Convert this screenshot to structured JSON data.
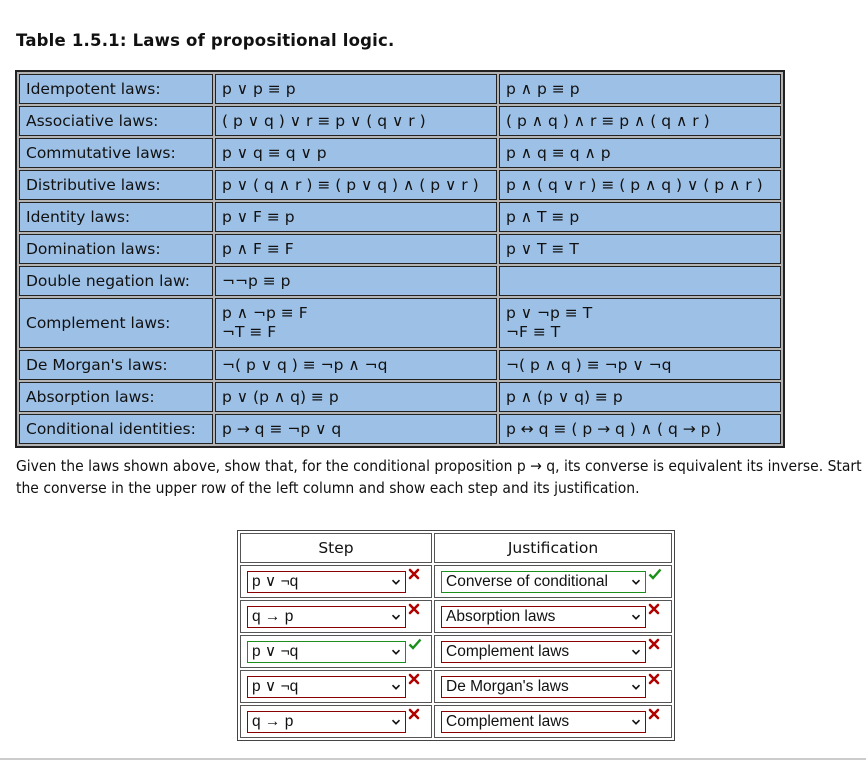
{
  "title": "Table 1.5.1: Laws of propositional logic.",
  "laws": [
    {
      "name": "Idempotent laws:",
      "left": [
        "p ∨ p ≡ p"
      ],
      "right": [
        "p ∧ p ≡ p"
      ]
    },
    {
      "name": "Associative laws:",
      "left": [
        "( p ∨ q ) ∨ r ≡ p ∨ ( q ∨ r )"
      ],
      "right": [
        "( p ∧ q ) ∧ r ≡ p ∧ ( q ∧ r )"
      ]
    },
    {
      "name": "Commutative laws:",
      "left": [
        "p ∨ q ≡ q ∨ p"
      ],
      "right": [
        "p ∧ q ≡ q ∧ p"
      ]
    },
    {
      "name": "Distributive laws:",
      "left": [
        "p ∨ ( q ∧ r ) ≡ ( p ∨ q ) ∧ ( p ∨ r )"
      ],
      "right": [
        "p ∧ ( q ∨ r ) ≡ ( p ∧ q ) ∨ ( p ∧ r )"
      ]
    },
    {
      "name": "Identity laws:",
      "left": [
        "p ∨ F ≡ p"
      ],
      "right": [
        "p ∧ T ≡ p"
      ]
    },
    {
      "name": "Domination laws:",
      "left": [
        "p ∧ F ≡ F"
      ],
      "right": [
        "p ∨ T ≡ T"
      ]
    },
    {
      "name": "Double negation law:",
      "left": [
        "¬¬p ≡ p"
      ],
      "right": []
    },
    {
      "name": "Complement laws:",
      "left": [
        "p ∧ ¬p ≡ F",
        "¬T ≡ F"
      ],
      "right": [
        "p ∨ ¬p ≡ T",
        "¬F ≡ T"
      ]
    },
    {
      "name": "De Morgan's laws:",
      "left": [
        "¬( p ∨ q ) ≡ ¬p ∧ ¬q"
      ],
      "right": [
        "¬( p ∧ q ) ≡ ¬p ∨ ¬q"
      ]
    },
    {
      "name": "Absorption laws:",
      "left": [
        "p ∨ (p ∧ q) ≡ p"
      ],
      "right": [
        "p ∧ (p ∨ q) ≡ p"
      ]
    },
    {
      "name": "Conditional identities:",
      "left": [
        "p → q ≡ ¬p ∨ q"
      ],
      "right": [
        "p ↔ q ≡ ( p → q ) ∧ ( q → p )"
      ]
    }
  ],
  "instructions": "Given the laws shown above, show that, for the conditional proposition p → q, its converse is equivalent its inverse. Start with the converse in the upper row of the left column and show each step and its justification.",
  "proof_table": {
    "headers": {
      "step": "Step",
      "justification": "Justification"
    },
    "rows": [
      {
        "step": "p ∨ ¬q",
        "step_status": "incorrect",
        "justification": "Converse of conditional",
        "justification_status": "correct"
      },
      {
        "step": "q → p",
        "step_status": "incorrect",
        "justification": "Absorption laws",
        "justification_status": "incorrect"
      },
      {
        "step": "p ∨ ¬q",
        "step_status": "correct",
        "justification": "Complement laws",
        "justification_status": "incorrect"
      },
      {
        "step": "p ∨ ¬q",
        "step_status": "incorrect",
        "justification": "De Morgan's laws",
        "justification_status": "incorrect"
      },
      {
        "step": "q → p",
        "step_status": "incorrect",
        "justification": "Complement laws",
        "justification_status": "incorrect"
      }
    ]
  },
  "icons": {
    "correct": "check-icon",
    "incorrect": "x-icon",
    "dropdown": "chevron-down-icon"
  },
  "colors": {
    "table_bg": "#9dc0e6",
    "correct": "#1a8f1a",
    "incorrect": "#8b0000"
  }
}
